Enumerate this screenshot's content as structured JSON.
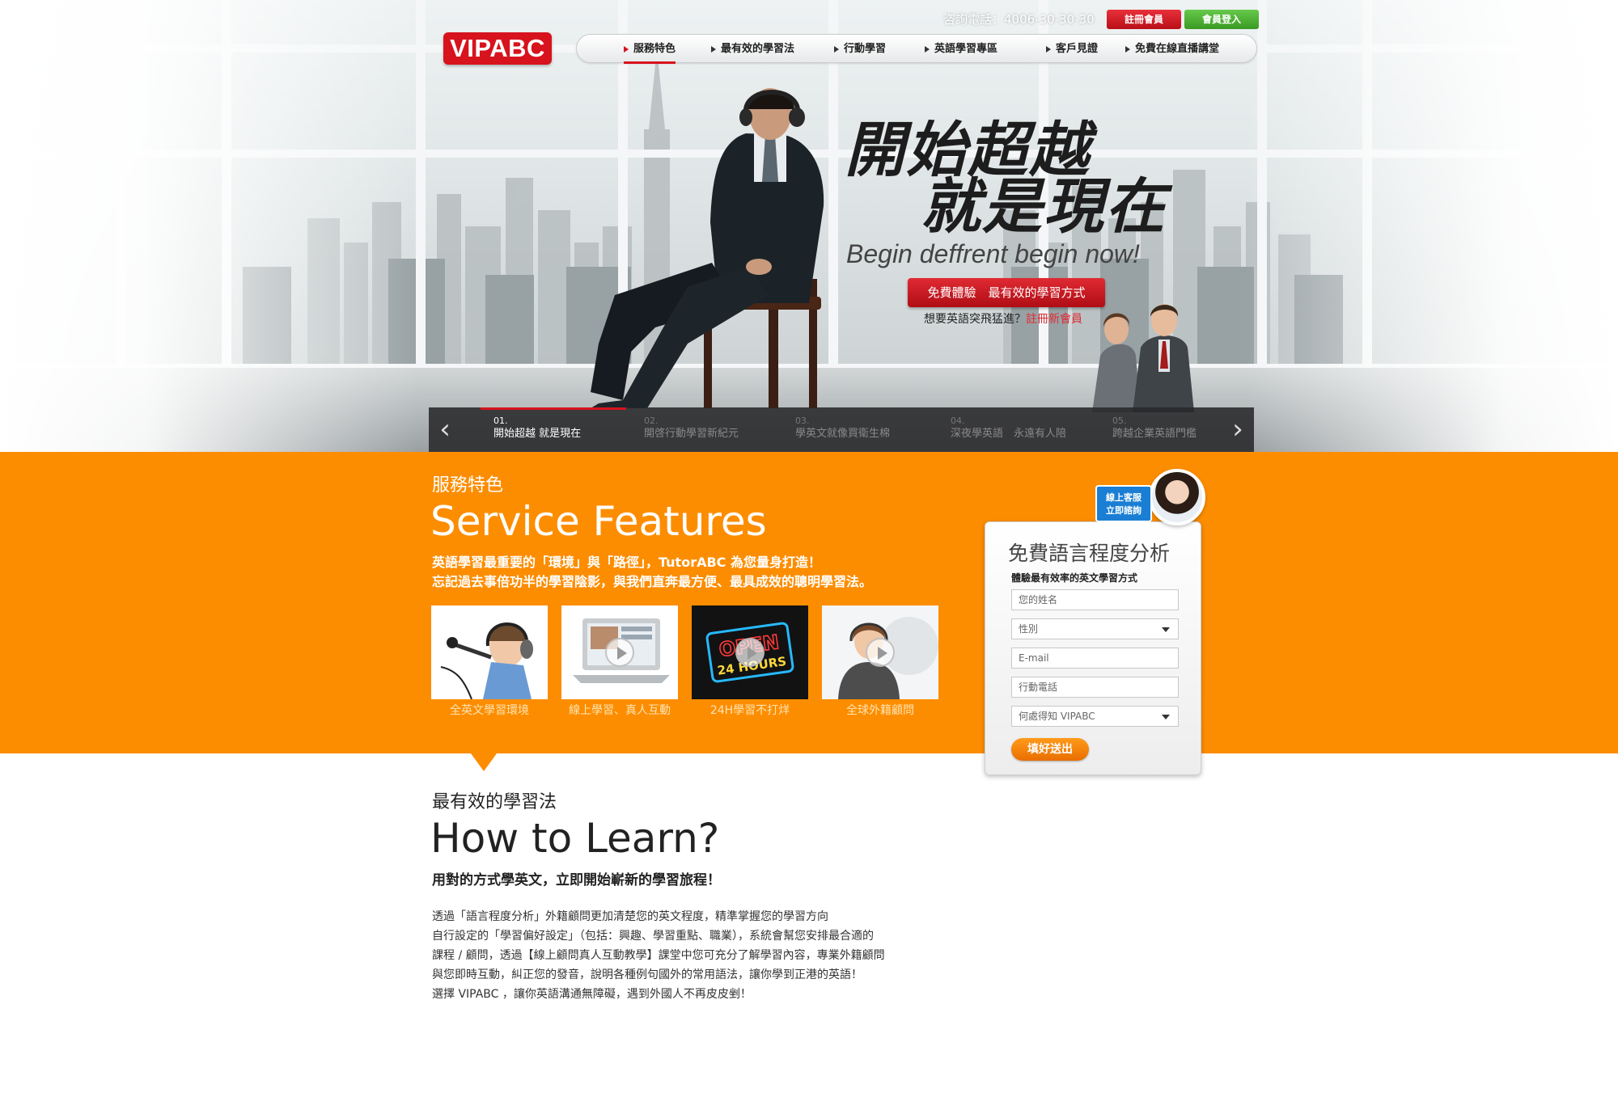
{
  "brand": {
    "logo_text": "VIPABC",
    "accent": "#d7131d",
    "band_color": "#fd8d00"
  },
  "header": {
    "hotline": "咨詢電話：4006-30-30-30",
    "register_label": "註冊會員",
    "login_label": "會員登入"
  },
  "nav": {
    "items": [
      {
        "label": "服務特色",
        "active": true
      },
      {
        "label": "最有效的學習法"
      },
      {
        "label": "行動學習"
      },
      {
        "label": "英語學習專區"
      },
      {
        "label": "客戶見證"
      },
      {
        "label": "免費在線直播講堂"
      }
    ]
  },
  "hero": {
    "headline_line1": "開始超越",
    "headline_line2": "就是現在",
    "tagline": "Begin deffrent begin now!",
    "cta_label": "免費體驗　最有效的學習方式",
    "note_text": "想要英語突飛猛進？",
    "note_link": "註冊新會員"
  },
  "slider": {
    "prev_icon": "chevron-left-icon",
    "next_icon": "chevron-right-icon",
    "items": [
      {
        "num": "01.",
        "title": "開始超越 就是現在",
        "active": true
      },
      {
        "num": "02.",
        "title": "開啓行動學習新紀元"
      },
      {
        "num": "03.",
        "title": "學英文就像買衛生棉"
      },
      {
        "num": "04.",
        "title": "深夜學英語　永遠有人陪"
      },
      {
        "num": "05.",
        "title": "跨越企業英語門檻"
      }
    ]
  },
  "service": {
    "title_zh": "服務特色",
    "title_en": "Service Features",
    "desc_line1": "英語學習最重要的「環境」與「路徑」，TutorABC 為您量身打造！",
    "desc_line2": "忘記過去事倍功半的學習陰影，與我們直奔最方便、最具成效的聰明學習法。",
    "features": [
      {
        "caption": "全英文學習環境"
      },
      {
        "caption": "線上學習、真人互動"
      },
      {
        "caption": "24H學習不打烊",
        "sign_top": "OPEN",
        "sign_bottom": "24 HOURS"
      },
      {
        "caption": "全球外籍顧問"
      }
    ]
  },
  "form": {
    "support_badge_line1": "線上客服",
    "support_badge_line2": "立即諮詢",
    "title": "免費語言程度分析",
    "subtitle": "體驗最有效率的英文學習方式",
    "name_placeholder": "您的姓名",
    "gender_placeholder": "性別",
    "email_placeholder": "E-mail",
    "phone_placeholder": "行動電話",
    "source_placeholder": "何處得知 VIPABC",
    "submit_label": "填好送出"
  },
  "learn": {
    "title_zh": "最有效的學習法",
    "title_en": "How to Learn?",
    "lead": "用對的方式學英文，立即開始嶄新的學習旅程！",
    "paragraph_lines": [
      "透過「語言程度分析」外籍顧問更加清楚您的英文程度，精準掌握您的學習方向",
      "自行設定的「學習偏好設定」（包括：興趣、學習重點、職業），系統會幫您安排最合適的",
      "課程 / 顧問，透過【線上顧問真人互動教學】課堂中您可充分了解學習內容，專業外籍顧問",
      "與您即時互動，糾正您的發音，說明各種例句國外的常用語法，讓你學到正港的英語！",
      "選擇 VIPABC ，讓你英語溝通無障礙，遇到外國人不再皮皮剉！"
    ]
  }
}
